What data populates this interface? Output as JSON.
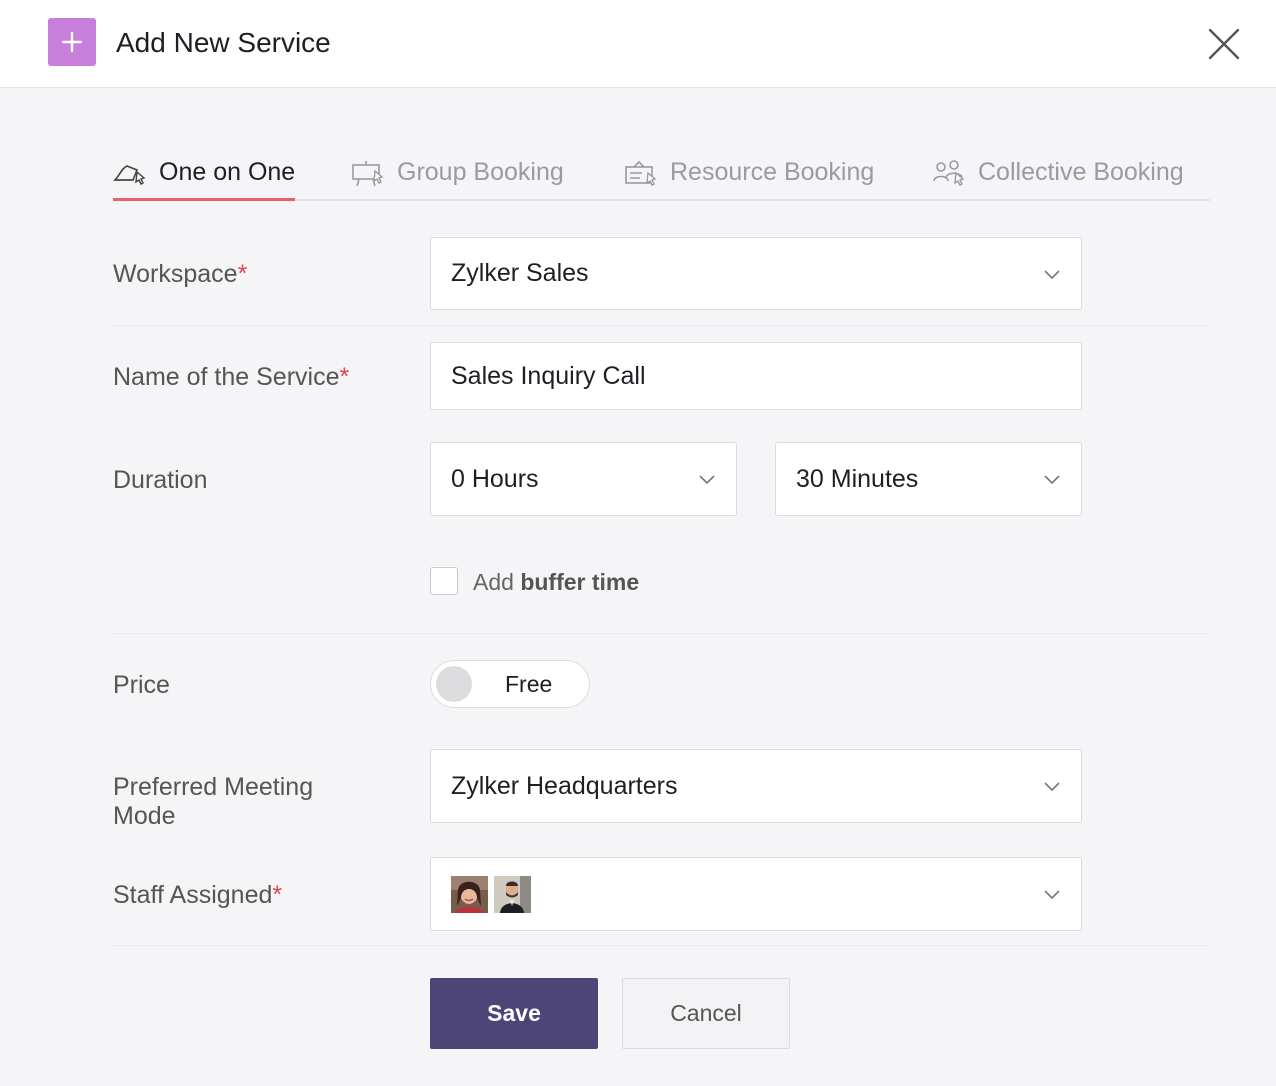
{
  "dialog": {
    "title": "Add New Service"
  },
  "tabs": [
    {
      "label": "One on One",
      "icon": "one-on-one-icon",
      "active": true
    },
    {
      "label": "Group Booking",
      "icon": "group-booking-icon",
      "active": false
    },
    {
      "label": "Resource Booking",
      "icon": "resource-booking-icon",
      "active": false
    },
    {
      "label": "Collective Booking",
      "icon": "collective-booking-icon",
      "active": false
    }
  ],
  "form": {
    "workspace": {
      "label": "Workspace",
      "required_mark": "*",
      "value": "Zylker Sales"
    },
    "service_name": {
      "label": "Name of the Service",
      "required_mark": "*",
      "value": "Sales Inquiry Call"
    },
    "duration": {
      "label": "Duration",
      "hours": "0 Hours",
      "minutes": "30 Minutes"
    },
    "buffer": {
      "label_prefix": "Add",
      "label_bold": "buffer time",
      "checked": false
    },
    "price": {
      "label": "Price",
      "toggle_text": "Free",
      "on": false
    },
    "meeting_mode": {
      "label_line1": "Preferred Meeting",
      "label_line2": "Mode",
      "value": "Zylker Headquarters"
    },
    "staff": {
      "label": "Staff Assigned",
      "required_mark": "*",
      "avatars": [
        "staff-avatar-woman",
        "staff-avatar-man"
      ]
    }
  },
  "actions": {
    "save_label": "Save",
    "cancel_label": "Cancel"
  },
  "colors": {
    "accent_plus": "#c77fdb",
    "tab_underline": "#e8606a",
    "required": "#e0464f",
    "primary_button": "#4d4478"
  }
}
